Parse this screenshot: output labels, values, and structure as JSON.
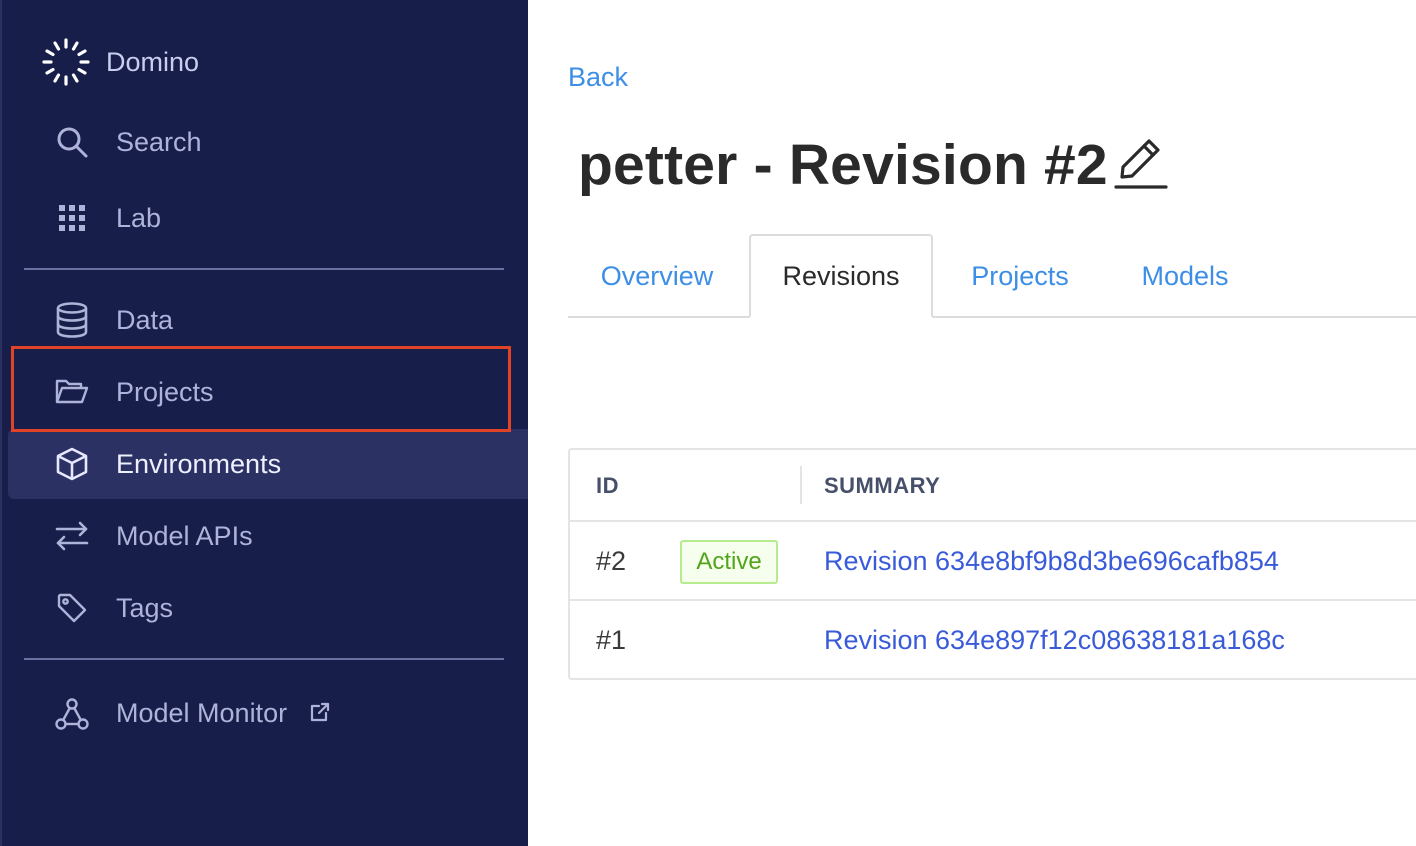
{
  "sidebar": {
    "brand": {
      "name": "Domino"
    },
    "items": [
      {
        "label": "Search",
        "icon": "search-icon"
      },
      {
        "label": "Lab",
        "icon": "grid-icon"
      },
      {
        "label": "Data",
        "icon": "database-icon"
      },
      {
        "label": "Projects",
        "icon": "folder-open-icon"
      },
      {
        "label": "Environments",
        "icon": "cube-icon",
        "active": true
      },
      {
        "label": "Model APIs",
        "icon": "swap-arrows-icon"
      },
      {
        "label": "Tags",
        "icon": "tag-icon"
      },
      {
        "label": "Model Monitor",
        "icon": "network-nodes-icon",
        "external": true
      }
    ]
  },
  "main": {
    "back_label": "Back",
    "title": "petter - Revision #2",
    "tabs": [
      {
        "label": "Overview"
      },
      {
        "label": "Revisions",
        "active": true
      },
      {
        "label": "Projects"
      },
      {
        "label": "Models"
      }
    ],
    "table": {
      "headers": {
        "id": "ID",
        "summary": "SUMMARY"
      },
      "rows": [
        {
          "id": "#2",
          "badge": "Active",
          "summary": "Revision 634e8bf9b8d3be696cafb854"
        },
        {
          "id": "#1",
          "badge": "",
          "summary": "Revision 634e897f12c08638181a168c"
        }
      ]
    }
  },
  "colors": {
    "sidebar_bg": "#181e4a",
    "active_item_bg": "#2b3163",
    "link_blue": "#3c8ee6",
    "summary_link": "#3a5bd9",
    "highlight_red": "#e04326",
    "badge_green": "#52a41a"
  }
}
